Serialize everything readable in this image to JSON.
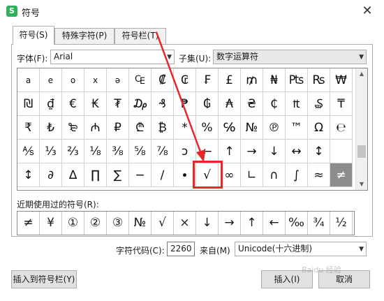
{
  "window": {
    "title": "符号",
    "app_icon": "S",
    "close": "✕"
  },
  "tabs": [
    {
      "label": "符号(S)",
      "active": true
    },
    {
      "label": "特殊字符(P)",
      "active": false
    },
    {
      "label": "符号栏(T)",
      "active": false
    }
  ],
  "font": {
    "label": "字体(F):",
    "value": "Arial"
  },
  "subset": {
    "label": "子集(U):",
    "value": "数字运算符"
  },
  "grid": [
    [
      "a",
      "e",
      "o",
      "x",
      "ə",
      "₠",
      "₡",
      "₢",
      "₣",
      "£",
      "₥",
      "₦",
      "₧",
      "₨",
      "₩"
    ],
    [
      "₪",
      "₫",
      "€",
      "₭",
      "₮",
      "₯",
      "₰",
      "₱",
      "₲",
      "₳",
      "₴",
      "₵",
      "₶",
      "₷",
      "₸"
    ],
    [
      "₹",
      "₺",
      "₻",
      "₼",
      "₽",
      "₾",
      "₿",
      "*",
      "%",
      "℅",
      "№",
      "℗",
      "™",
      "Ω",
      "℮"
    ],
    [
      "⅍",
      "⅓",
      "⅔",
      "⅛",
      "⅜",
      "⅝",
      "⅞",
      "ↄ",
      "←",
      "↑",
      "→",
      "↓",
      "↔",
      "↕",
      ""
    ],
    [
      "↕",
      "∂",
      "∆",
      "∏",
      "∑",
      "−",
      "∕",
      "∙",
      "√",
      "∞",
      "∟",
      "∩",
      "∫",
      "≈",
      "≠"
    ]
  ],
  "recent": {
    "label": "近期使用过的符号(R):",
    "symbols": [
      "≠",
      "¥",
      "①",
      "②",
      "③",
      "№",
      "√",
      "×",
      "↓",
      "→",
      "↑",
      "←",
      "‰",
      "¾",
      "½"
    ]
  },
  "charcode": {
    "label": "字符代码(C):",
    "value": "2260",
    "from_label": "来自(M)",
    "from_value": "Unicode(十六进制)"
  },
  "buttons": {
    "insert_to_bar": "插入到符号栏(Y)",
    "insert": "插入(I)",
    "cancel": "取消"
  },
  "watermark": "Baidu 经验"
}
